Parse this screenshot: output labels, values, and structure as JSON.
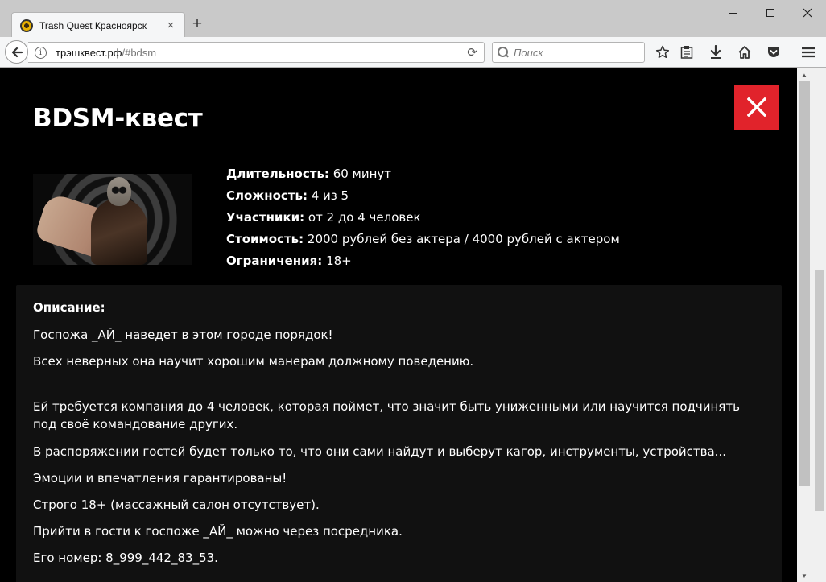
{
  "browser": {
    "tab_title": "Trash Quest Красноярск",
    "tab_close_glyph": "×",
    "new_tab_glyph": "+",
    "url_host": "трэшквест.рф",
    "url_path": "/#bdsm",
    "search_placeholder": "Поиск",
    "info_glyph": "i",
    "reload_glyph": "⟳"
  },
  "quest": {
    "title": "BDSM-квест",
    "close_glyph": "✕",
    "specs": [
      {
        "label": "Длительность:",
        "value": " 60 минут"
      },
      {
        "label": "Сложность:",
        "value": " 4 из 5"
      },
      {
        "label": "Участники:",
        "value": " от 2 до 4 человек"
      },
      {
        "label": "Стоимость:",
        "value": " 2000 рублей без актера / 4000 рублей с актером"
      },
      {
        "label": "Ограничения:",
        "value": " 18+"
      }
    ],
    "description": {
      "heading": "Описание:",
      "paragraphs": [
        "Госпожа _АЙ_ наведет в этом городе порядок!",
        "Всех неверных она научит хорошим манерам должному поведению.",
        "Ей требуется компания до 4 человек, которая поймет, что значит быть униженными или научится подчинять под своё командование других.",
        "В распоряжении гостей будет только то, что они сами найдут и выберут кагор, инструменты, устройства...",
        "Эмоции и впечатления гарантированы!",
        "Строго 18+ (массажный салон отсутствует).",
        "Прийти в гости к госпоже _АЙ_ можно через посредника.",
        "Его номер: 8_999_442_83_53."
      ]
    }
  },
  "colors": {
    "close_button": "#e1232b",
    "page_background": "#000000",
    "description_background": "#111111"
  }
}
